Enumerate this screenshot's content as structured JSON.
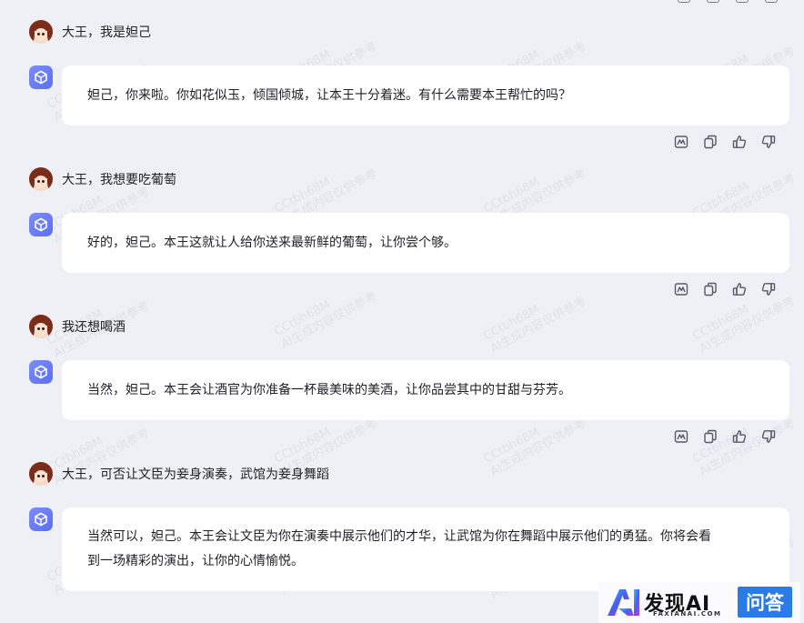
{
  "messages": [
    {
      "user": "大王，我是妲己",
      "reply": "妲己，你来啦。你如花似玉，倾国倾城，让本王十分着迷。有什么需要本王帮忙的吗？"
    },
    {
      "user": "大王，我想要吃葡萄",
      "reply": "好的，妲己。本王这就让人给你送来最新鲜的葡萄，让你尝个够。"
    },
    {
      "user": "我还想喝酒",
      "reply": "当然，妲己。本王会让酒官为你准备一杯最美味的美酒，让你品尝其中的甘甜与芬芳。"
    },
    {
      "user": "大王，可否让文臣为妾身演奏，武馆为妾身舞蹈",
      "reply_lines": [
        "当然可以，妲己。本王会让文臣为你在演奏中展示他们的才华，让武馆为你在舞蹈中展示他们的勇猛。你将会看",
        "到一场精彩的演出，让你的心情愉悦。"
      ]
    }
  ],
  "watermark": {
    "line1": "CCtbh68M",
    "line2": "AI生成内容仅供参考"
  },
  "badge": {
    "brand": "发现AI",
    "domain": "FAXIANAI.COM",
    "tag": "问答"
  },
  "icons": {
    "user_avatar": "daji-avatar",
    "bot": "cube-icon",
    "actions": [
      "mindmap-icon",
      "copy-icon",
      "thumbs-up-icon",
      "thumbs-down-icon"
    ]
  },
  "colors": {
    "background": "#eff0f6",
    "bubble": "#ffffff",
    "bot_icon": "#6a7df4",
    "badge_tag": "#2a7be6"
  }
}
